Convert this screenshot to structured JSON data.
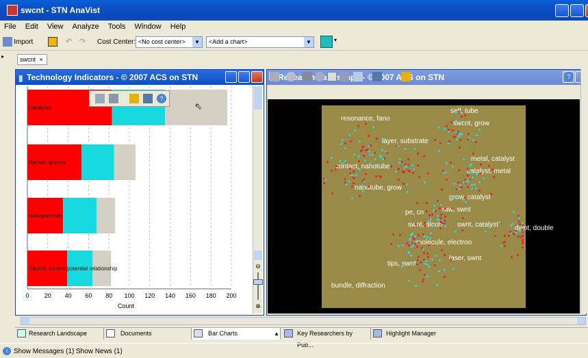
{
  "window": {
    "title": "swcnt - STN AnaVist"
  },
  "menu": [
    "File",
    "Edit",
    "View",
    "Analyze",
    "Tools",
    "Window",
    "Help"
  ],
  "toolbar": {
    "import_label": "Import",
    "cost_center_label": "Cost Center:",
    "cost_center_value": "<No cost center>",
    "add_chart_value": "<Add a chart>"
  },
  "doc_tab": {
    "label": "swcnt"
  },
  "tech_pane": {
    "title": "Technology Indicators - © 2007 ACS on STN"
  },
  "research_pane": {
    "title": "Research Landscape - © 2007 ACS on STN"
  },
  "chart_data": {
    "type": "bar",
    "orientation": "horizontal",
    "stacked": true,
    "categories": [
      "Catalysts",
      "Raman spectra",
      "Nanoparticles",
      "Electric current-potential relationship"
    ],
    "series": [
      {
        "color": "#ff0000",
        "values": [
          83,
          53,
          35,
          39
        ]
      },
      {
        "color": "#17d9e0",
        "values": [
          52,
          32,
          33,
          25
        ]
      },
      {
        "color": "#d4d0c4",
        "values": [
          61,
          21,
          18,
          18
        ]
      }
    ],
    "xlabel": "Count",
    "xticks": [
      "0",
      "20",
      "40",
      "60",
      "80",
      "100",
      "120",
      "140",
      "160",
      "180",
      "200"
    ],
    "xlim": [
      0,
      200
    ],
    "grid": true
  },
  "map_labels": [
    "resonance, fano",
    "self, tube",
    "swcnt, grow",
    "layer, substrate",
    "metal, catalyst",
    "contact, nanotube",
    "catalyst, metal",
    "nanotube, grow",
    "grow, catalyst",
    "pe, cn",
    "raw, swnt",
    "swnt, alcoh",
    "swnt, catalyst",
    "dwnt, double",
    "molecule, electron",
    "laser, swnt",
    "tips, swnt",
    "bundle, diffraction"
  ],
  "bottom_tabs": [
    "Research Landscape",
    "Documents",
    "Bar Charts",
    "Key Researchers by Pub...",
    "Highlight Manager"
  ],
  "status": {
    "messages": "Show Messages (1)",
    "news": "Show News (1)"
  }
}
